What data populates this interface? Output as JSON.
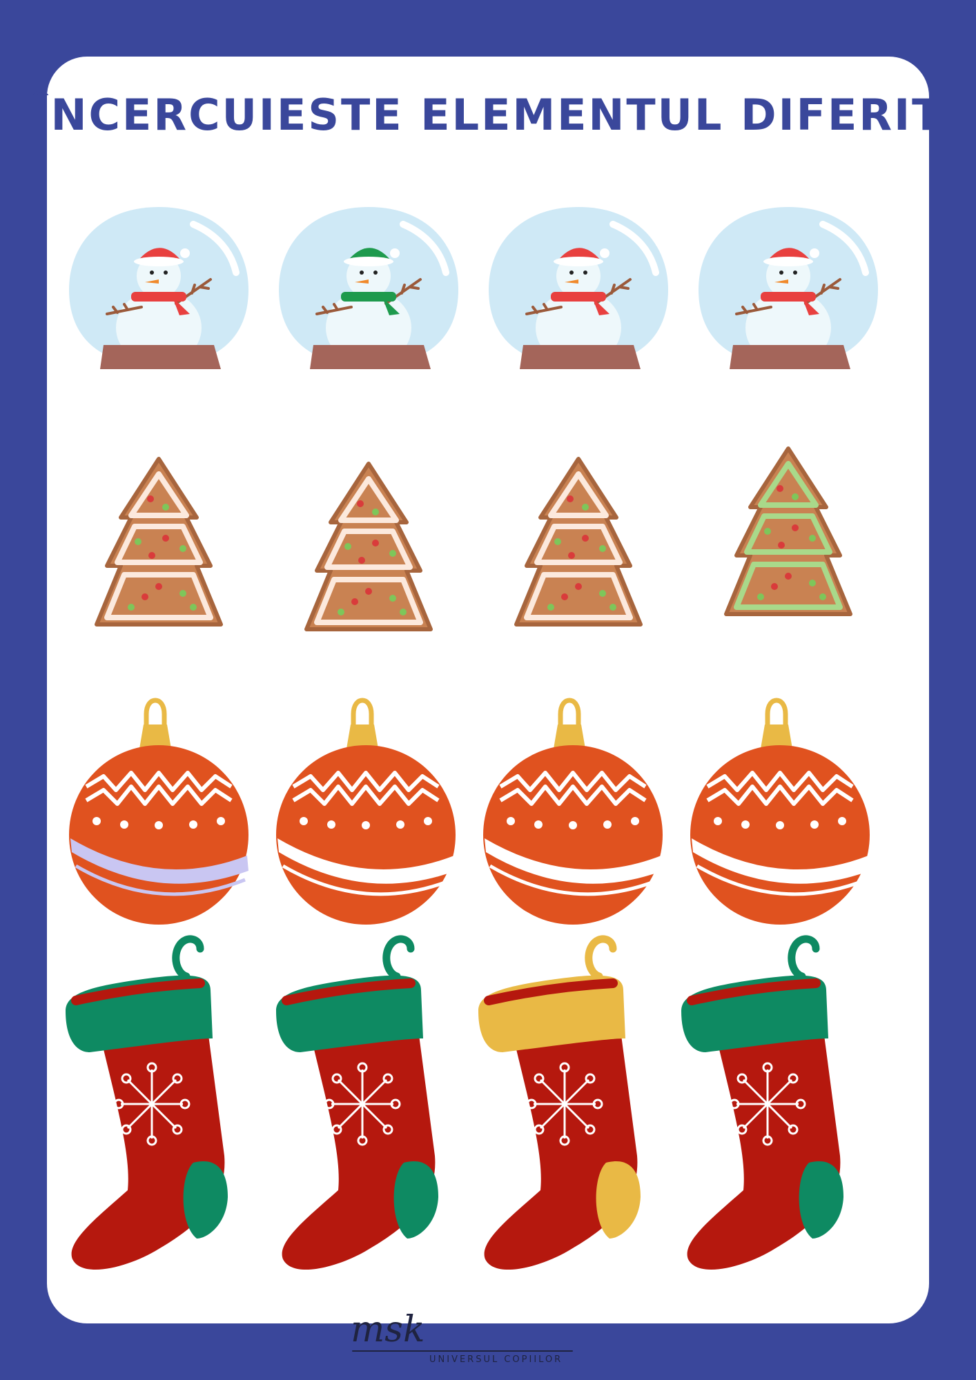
{
  "title": "ÎNCERCUIESTE ELEMENTUL DIFERIT",
  "rows": [
    {
      "name": "snow-globe",
      "accents": [
        "#e8403f",
        "#1e9a4d",
        "#e8403f",
        "#e8403f"
      ]
    },
    {
      "name": "gingerbread-tree",
      "accents": [
        "#fce9dd",
        "#fce9dd",
        "#fce9dd",
        "#a9d98a"
      ]
    },
    {
      "name": "ornament-ball",
      "accents": [
        "#c9c6f2",
        "#ffffff",
        "#ffffff",
        "#ffffff"
      ]
    },
    {
      "name": "christmas-stocking",
      "accents": [
        "#0e8a62",
        "#0e8a62",
        "#e9b945",
        "#0e8a62"
      ]
    }
  ],
  "brand": {
    "script": "msk",
    "tagline": "UNIVERSUL COPIILOR"
  },
  "colors": {
    "background": "#3a479b",
    "card": "#ffffff",
    "title": "#3a479b"
  }
}
